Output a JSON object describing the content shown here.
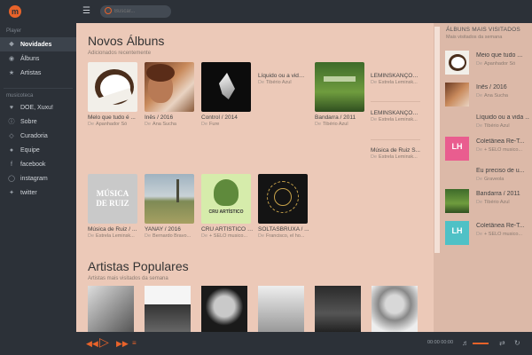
{
  "app": {
    "logo_letter": "m"
  },
  "search": {
    "placeholder": "Buscar..."
  },
  "sidebar": {
    "section_player": "Player",
    "player_items": [
      {
        "label": "Novidades",
        "icon": "compass-icon"
      },
      {
        "label": "Álbuns",
        "icon": "disc-icon"
      },
      {
        "label": "Artistas",
        "icon": "star-icon"
      }
    ],
    "section_musicoteca": "musicoteca",
    "musicoteca_items": [
      {
        "label": "DOE, Xuxu!",
        "icon": "heart-icon"
      },
      {
        "label": "Sobre",
        "icon": "info-icon"
      },
      {
        "label": "Curadoria",
        "icon": "diamond-icon"
      },
      {
        "label": "Equipe",
        "icon": "team-icon"
      },
      {
        "label": "facebook",
        "icon": "facebook-icon"
      },
      {
        "label": "instagram",
        "icon": "instagram-icon"
      },
      {
        "label": "twitter",
        "icon": "twitter-icon"
      }
    ]
  },
  "novos": {
    "title": "Novos Álbuns",
    "subtitle": "Adicionados recentemente",
    "prefix": "De",
    "albums": [
      {
        "title": "Melo que tudo é ...",
        "artist": "Apanhador Só",
        "icon": "coconut-cover"
      },
      {
        "title": "Inês / 2016",
        "artist": "Ana Sucha",
        "icon": "portrait-cover"
      },
      {
        "title": "Control / 2014",
        "artist": "Fure",
        "icon": "dark-cover"
      },
      {
        "title": "Líquido ou a vida ...",
        "artist": "Tibério Azul",
        "icon": "none"
      },
      {
        "title": "Bandarra / 2011",
        "artist": "Tibério Azul",
        "icon": "green-cover"
      },
      {
        "title": "LEMINSKANÇÕES ...",
        "artist": "Estrela Leminsk...",
        "icon": "none"
      },
      {
        "title": "LEMINSKANÇÕES ...",
        "artist": "Estrela Leminsk...",
        "icon": "none"
      },
      {
        "title": "Música de Ruiz S...",
        "artist": "Estrela Leminsk...",
        "icon": "none"
      },
      {
        "title": "Música de Ruiz / ...",
        "artist": "Estrela Leminsk...",
        "icon": "ruiz-cover",
        "cover_text": "MÚSICA DE RUIZ"
      },
      {
        "title": "YANAY / 2016",
        "artist": "Bernardo Bravo...",
        "icon": "landscape-cover"
      },
      {
        "title": "CRU ARTÍSTICO / ...",
        "artist": "+ SELO musico...",
        "icon": "lettuce-cover",
        "cover_text": "CRU ARTÍSTICO"
      },
      {
        "title": "SOLTASBRUXA / ...",
        "artist": "Francisco, el ho...",
        "icon": "bruxa-cover"
      }
    ]
  },
  "artistas": {
    "title": "Artistas Populares",
    "subtitle": "Artistas mais visitados da semana",
    "items": [
      "artist-photo-1",
      "artist-photo-2",
      "artist-photo-3",
      "artist-photo-4",
      "artist-photo-5",
      "artist-photo-6"
    ]
  },
  "right": {
    "title": "ÁLBUNS MAIS VISITADOS",
    "subtitle": "Mais visitados da semana",
    "prefix": "De",
    "items": [
      {
        "title": "Meio que tudo ...",
        "artist": "Apanhador Só",
        "icon": "coconut-cover"
      },
      {
        "title": "Inês / 2016",
        "artist": "Ana Sucha",
        "icon": "portrait-cover"
      },
      {
        "title": "Líquido ou a vida ...",
        "artist": "Tibério Azul",
        "icon": "none"
      },
      {
        "title": "Coletânea Re-T...",
        "artist": "+ SELO musico...",
        "icon": "lh-cover",
        "cover_text": "LH"
      },
      {
        "title": "Eu preciso de u...",
        "artist": "Graveola",
        "icon": "none"
      },
      {
        "title": "Bandarra / 2011",
        "artist": "Tibério Azul",
        "icon": "green-cover"
      },
      {
        "title": "Coletânea Re-T...",
        "artist": "+ SELO musico...",
        "icon": "lh-cover",
        "cover_text": "LH"
      }
    ]
  },
  "player": {
    "time": "00:00 00:00"
  },
  "colors": {
    "accent": "#e8632a",
    "dark": "#2c3138",
    "background": "#ecc9b8"
  }
}
